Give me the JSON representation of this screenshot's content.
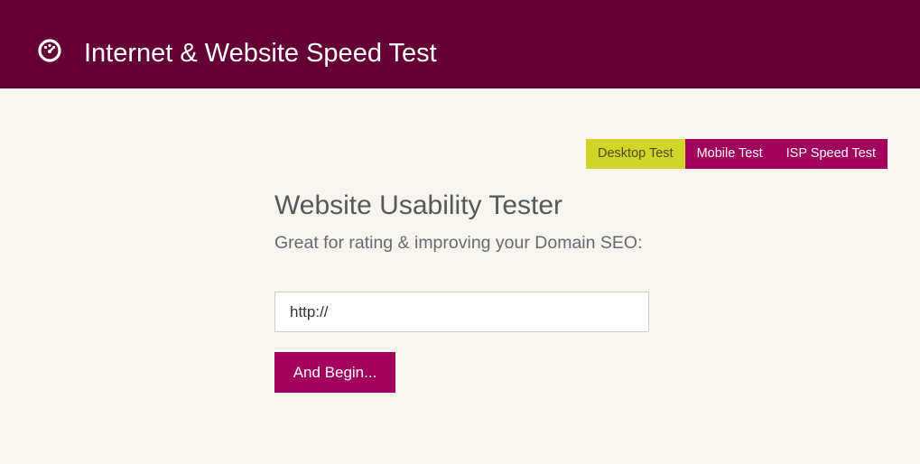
{
  "header": {
    "title": "Internet & Website Speed Test",
    "logo_icon": "speedometer-icon",
    "background_color": "#640035"
  },
  "tabs": [
    {
      "label": "Desktop Test",
      "active": true
    },
    {
      "label": "Mobile Test",
      "active": false
    },
    {
      "label": "ISP Speed Test",
      "active": false
    }
  ],
  "main": {
    "heading": "Website Usability Tester",
    "subheading": "Great for rating & improving your Domain SEO:",
    "url_input": {
      "value": "http://",
      "placeholder": ""
    },
    "submit_label": "And Begin..."
  },
  "colors": {
    "page_background": "#f8f5ee",
    "accent": "#a3005e",
    "active_tab": "#d0d628"
  }
}
